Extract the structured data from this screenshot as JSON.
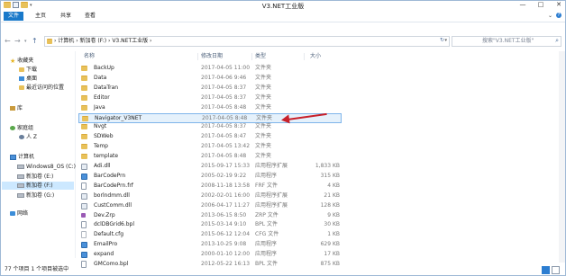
{
  "window": {
    "title": "V3.NET工业版"
  },
  "quick_access_toolbar": {
    "icons": [
      "folder-icon",
      "properties-icon",
      "new-folder-icon",
      "dropdown-icon"
    ]
  },
  "ribbon": {
    "tabs": [
      "文件",
      "主页",
      "共享",
      "查看"
    ],
    "help": "?"
  },
  "window_buttons": {
    "minimize": "—",
    "maximize": "□",
    "close": "✕"
  },
  "address": {
    "crumbs": "›  计算机  ›  新加卷 (F:)  ›  V3.NET工业版  ›",
    "search_placeholder": "搜索\"V3.NET工业版\""
  },
  "sidebar": {
    "items": [
      {
        "label": "收藏夹",
        "icon": "star-icon"
      },
      {
        "label": "下载",
        "icon": "download-folder-icon"
      },
      {
        "label": "桌面",
        "icon": "desktop-icon"
      },
      {
        "label": "最近访问的位置",
        "icon": "recent-places-icon"
      },
      {
        "label": "库",
        "icon": "libraries-icon"
      },
      {
        "label": "家庭组",
        "icon": "homegroup-icon"
      },
      {
        "label": "人 Z",
        "icon": "user-icon"
      },
      {
        "label": "计算机",
        "icon": "computer-icon"
      },
      {
        "label": "Windows8_OS (C:)",
        "icon": "drive-icon"
      },
      {
        "label": "新加卷 (E:)",
        "icon": "drive-icon"
      },
      {
        "label": "新加卷 (F:)",
        "icon": "drive-icon"
      },
      {
        "label": "新加卷 (G:)",
        "icon": "drive-icon"
      },
      {
        "label": "网络",
        "icon": "network-icon"
      }
    ]
  },
  "columns": {
    "name": "名称",
    "date": "修改日期",
    "type": "类型",
    "size": "大小"
  },
  "files": [
    {
      "name": "BackUp",
      "date": "2017-04-05 11:00",
      "type": "文件夹",
      "size": "",
      "icon": "folder-icon"
    },
    {
      "name": "Data",
      "date": "2017-04-06 9:46",
      "type": "文件夹",
      "size": "",
      "icon": "folder-icon"
    },
    {
      "name": "DataTran",
      "date": "2017-04-05 8:37",
      "type": "文件夹",
      "size": "",
      "icon": "folder-icon"
    },
    {
      "name": "Editor",
      "date": "2017-04-05 8:37",
      "type": "文件夹",
      "size": "",
      "icon": "folder-icon"
    },
    {
      "name": "Java",
      "date": "2017-04-05 8:48",
      "type": "文件夹",
      "size": "",
      "icon": "folder-icon"
    },
    {
      "name": "Navigator_V3NET",
      "date": "2017-04-05 8:48",
      "type": "文件夹",
      "size": "",
      "icon": "folder-icon"
    },
    {
      "name": "Nvgt",
      "date": "2017-04-05 8:37",
      "type": "文件夹",
      "size": "",
      "icon": "folder-icon"
    },
    {
      "name": "SDWeb",
      "date": "2017-04-05 8:47",
      "type": "文件夹",
      "size": "",
      "icon": "folder-icon"
    },
    {
      "name": "Temp",
      "date": "2017-04-05 13:42",
      "type": "文件夹",
      "size": "",
      "icon": "folder-icon"
    },
    {
      "name": "template",
      "date": "2017-04-05 8:48",
      "type": "文件夹",
      "size": "",
      "icon": "folder-icon"
    },
    {
      "name": "Adi.dll",
      "date": "2015-09-17 15:33",
      "type": "应用程序扩展",
      "size": "1,833 KB",
      "icon": "dll-icon"
    },
    {
      "name": "BarCodePrn",
      "date": "2005-02-19 9:22",
      "type": "应用程序",
      "size": "315 KB",
      "icon": "exe-icon"
    },
    {
      "name": "BarCodePrn.frf",
      "date": "2008-11-18 13:58",
      "type": "FRF 文件",
      "size": "4 KB",
      "icon": "file-icon"
    },
    {
      "name": "borlndmm.dll",
      "date": "2002-02-01 16:00",
      "type": "应用程序扩展",
      "size": "21 KB",
      "icon": "dll-icon"
    },
    {
      "name": "CustComm.dll",
      "date": "2006-04-17 11:27",
      "type": "应用程序扩展",
      "size": "128 KB",
      "icon": "dll-icon"
    },
    {
      "name": "Dev.Zrp",
      "date": "2013-06-15 8:50",
      "type": "ZRP 文件",
      "size": "9 KB",
      "icon": "zrp-icon"
    },
    {
      "name": "dclDBGrid6.bpl",
      "date": "2015-03-14 9:10",
      "type": "BPL 文件",
      "size": "30 KB",
      "icon": "file-icon"
    },
    {
      "name": "Default.cfg",
      "date": "2015-06-12 12:04",
      "type": "CFG 文件",
      "size": "1 KB",
      "icon": "cfg-icon"
    },
    {
      "name": "EmailPro",
      "date": "2013-10-25 9:08",
      "type": "应用程序",
      "size": "629 KB",
      "icon": "exe-icon"
    },
    {
      "name": "expand",
      "date": "2000-01-10 12:00",
      "type": "应用程序",
      "size": "17 KB",
      "icon": "exe-icon"
    },
    {
      "name": "GMComo.bpl",
      "date": "2012-05-22 16:13",
      "type": "BPL 文件",
      "size": "875 KB",
      "icon": "file-icon"
    }
  ],
  "status": {
    "text": "77 个项目   1 个项目被选中"
  },
  "colors": {
    "accent": "#1979ca",
    "selection": "#cce8ff",
    "arrow": "#c8202a"
  }
}
